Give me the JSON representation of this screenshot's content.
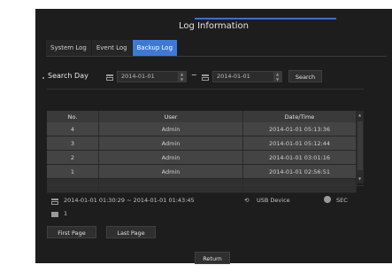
{
  "title": "Log Information",
  "tabs": [
    {
      "label": "System Log"
    },
    {
      "label": "Event Log"
    },
    {
      "label": "Backup Log"
    }
  ],
  "search": {
    "label": "Search Day",
    "start_date": "2014-01-01",
    "separator": "~",
    "end_date": "2014-01-01",
    "button": "Search"
  },
  "table": {
    "headers": [
      "No.",
      "User",
      "Date/Time"
    ],
    "rows": [
      {
        "no": "4",
        "user": "Admin",
        "datetime": "2014-01-01 05:13:36"
      },
      {
        "no": "3",
        "user": "Admin",
        "datetime": "2014-01-01 05:12:44"
      },
      {
        "no": "2",
        "user": "Admin",
        "datetime": "2014-01-01 03:01:16"
      },
      {
        "no": "1",
        "user": "Admin",
        "datetime": "2014-01-01 02:56:51"
      }
    ]
  },
  "details": {
    "range": "2014-01-01 01:30:29 ~ 2014-01-01 01:43:45",
    "device": "USB Device",
    "format": "SEC",
    "channel": "1"
  },
  "paging": {
    "first": "First Page",
    "last": "Last Page"
  },
  "return_label": "Return",
  "colors": {
    "accent": "#3d7ad8",
    "background": "#1d1d1d"
  }
}
